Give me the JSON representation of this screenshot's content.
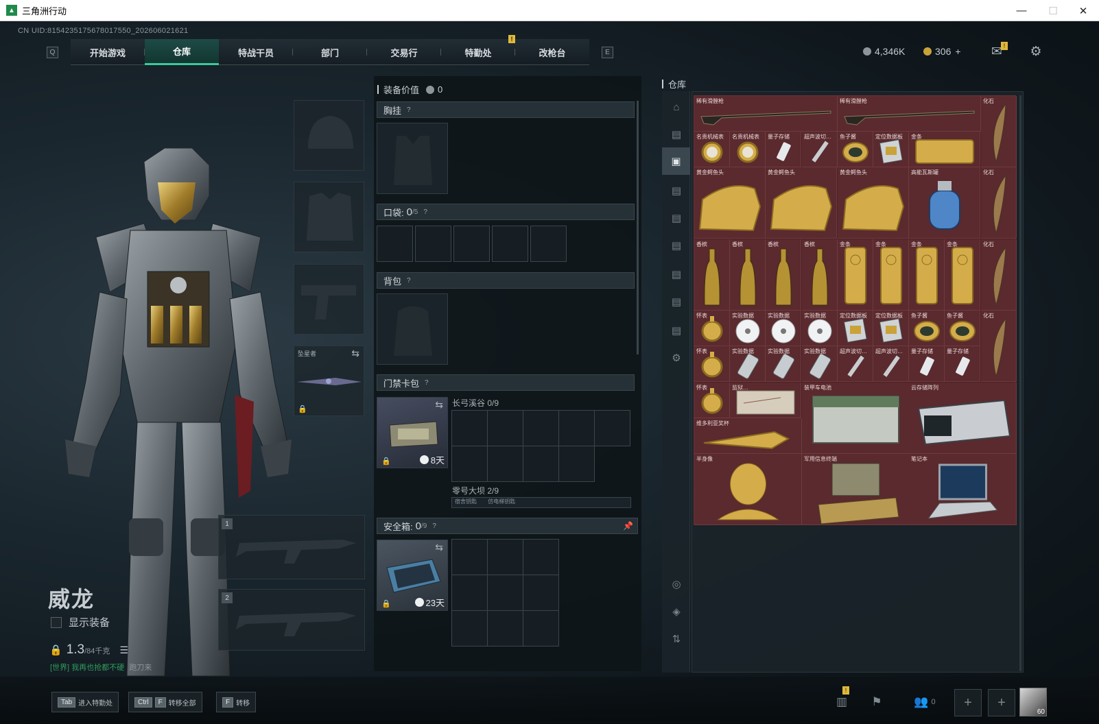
{
  "window": {
    "title": "三角洲行动",
    "minimize": "—",
    "maximize": "☐",
    "close": "✕"
  },
  "uid": "CN UID:8154235175678017550_202606021621",
  "nav": {
    "left_key": "Q",
    "right_key": "E",
    "tabs": [
      {
        "label": "开始游戏"
      },
      {
        "label": "仓库",
        "active": true
      },
      {
        "label": "特战干员"
      },
      {
        "label": "部门"
      },
      {
        "label": "交易行"
      },
      {
        "label": "特勤处",
        "badge": "!"
      },
      {
        "label": "改枪台"
      }
    ]
  },
  "currency": {
    "coins": "4,346K",
    "premium": "306",
    "premium_add": "+",
    "mail_badge": "!"
  },
  "character": {
    "name": "威龙",
    "show_equipment": "显示装备",
    "weight_value": "1.3",
    "weight_max": "/84千克",
    "chat_channel": "[世界]",
    "chat_text": "我再也抢都不硬",
    "chat_user": "跑刀来"
  },
  "slots": {
    "melee_label": "坠星者",
    "primary_num": "1",
    "secondary_num": "2"
  },
  "equip_panel": {
    "value_label": "装备价值",
    "value": "0",
    "chest_rig": "胸挂",
    "pocket_label": "口袋:",
    "pocket_count": "0",
    "pocket_max": "/5",
    "backpack": "背包",
    "keycard": "门禁卡包",
    "keycard_map1": "长弓溪谷 0/9",
    "keycard_map2": "零号大坝 2/9",
    "keycard_timer": "8天",
    "mini_tag1": "宿舍钥匙",
    "mini_tag2": "仿电梯钥匙",
    "safe_label": "安全箱:",
    "safe_count": "0",
    "safe_max": "/9",
    "safe_timer": "23天",
    "help": "?"
  },
  "stash": {
    "title": "仓库",
    "items": [
      {
        "label": "稀有滑膛枪",
        "kind": "musket"
      },
      {
        "label": "稀有滑膛枪",
        "kind": "musket"
      },
      {
        "label": "化石",
        "kind": "fossil"
      },
      {
        "label": "名贵机械表",
        "kind": "watch"
      },
      {
        "label": "名贵机械表",
        "kind": "watch"
      },
      {
        "label": "量子存储",
        "kind": "usb"
      },
      {
        "label": "超声波切…",
        "kind": "pen"
      },
      {
        "label": "鱼子酱",
        "kind": "caviar"
      },
      {
        "label": "定位数据板",
        "kind": "device"
      },
      {
        "label": "金条",
        "kind": "goldbar-h"
      },
      {
        "label": "黄金鳄鱼头",
        "kind": "croc"
      },
      {
        "label": "黄金鳄鱼头",
        "kind": "croc"
      },
      {
        "label": "黄金鳄鱼头",
        "kind": "croc"
      },
      {
        "label": "高能瓦斯罐",
        "kind": "gas"
      },
      {
        "label": "化石",
        "kind": "fossil"
      },
      {
        "label": "香槟",
        "kind": "bottle"
      },
      {
        "label": "香槟",
        "kind": "bottle"
      },
      {
        "label": "香槟",
        "kind": "bottle"
      },
      {
        "label": "香槟",
        "kind": "bottle"
      },
      {
        "label": "金条",
        "kind": "goldbar-v"
      },
      {
        "label": "金条",
        "kind": "goldbar-v"
      },
      {
        "label": "金条",
        "kind": "goldbar-v"
      },
      {
        "label": "金条",
        "kind": "goldbar-v"
      },
      {
        "label": "化石",
        "kind": "fossil"
      },
      {
        "label": "怀表",
        "kind": "pocketwatch"
      },
      {
        "label": "实验数据",
        "kind": "disc"
      },
      {
        "label": "实验数据",
        "kind": "disc"
      },
      {
        "label": "实验数据",
        "kind": "disc"
      },
      {
        "label": "定位数据板",
        "kind": "device"
      },
      {
        "label": "定位数据板",
        "kind": "device"
      },
      {
        "label": "鱼子酱",
        "kind": "caviar"
      },
      {
        "label": "鱼子酱",
        "kind": "caviar"
      },
      {
        "label": "化石",
        "kind": "fossil"
      },
      {
        "label": "怀表",
        "kind": "pocketwatch"
      },
      {
        "label": "实验数据",
        "kind": "vial"
      },
      {
        "label": "实验数据",
        "kind": "vial"
      },
      {
        "label": "实验数据",
        "kind": "vial"
      },
      {
        "label": "超声波切…",
        "kind": "pen"
      },
      {
        "label": "超声波切…",
        "kind": "pen"
      },
      {
        "label": "量子存储",
        "kind": "usb"
      },
      {
        "label": "量子存储",
        "kind": "usb"
      },
      {
        "label": "怀表",
        "kind": "pocketwatch"
      },
      {
        "label": "监狱…",
        "kind": "map"
      },
      {
        "label": "装甲车电池",
        "kind": "battery"
      },
      {
        "label": "云存储阵列",
        "kind": "server"
      },
      {
        "label": "维多利亚奖杯",
        "kind": "trophy"
      },
      {
        "label": "半身像",
        "kind": "bust"
      },
      {
        "label": "军用信息终端",
        "kind": "terminal"
      },
      {
        "label": "笔记本",
        "kind": "laptop"
      }
    ]
  },
  "bottom": {
    "hint1_key": "Tab",
    "hint1_text": "进入特勤处",
    "hint2_key1": "Ctrl",
    "hint2_key2": "F",
    "hint2_text": "转移全部",
    "hint3_key": "F",
    "hint3_text": "转移",
    "friends_count": "0",
    "level": "60",
    "stats_badge": "!"
  },
  "colors": {
    "accent": "#3cc99a",
    "stash_bg": "#4a2024",
    "gold": "#c9a23a"
  }
}
